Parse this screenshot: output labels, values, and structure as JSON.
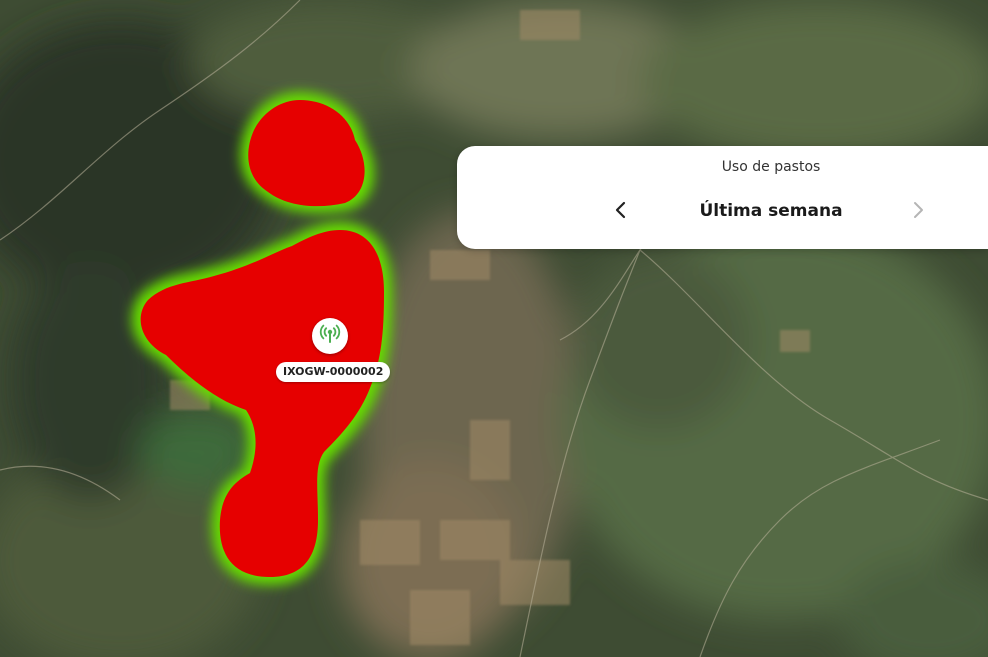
{
  "map": {
    "gateway": {
      "id": "IXOGW-0000002",
      "icon": "antenna-icon"
    },
    "heatmap": {
      "core_color": "#e60000",
      "edge_color": "#66dd00"
    }
  },
  "period_panel": {
    "title": "Uso de pastos",
    "period_label": "Última semana",
    "prev_icon": "chevron-left-icon",
    "next_icon": "chevron-right-icon",
    "next_enabled": false
  }
}
